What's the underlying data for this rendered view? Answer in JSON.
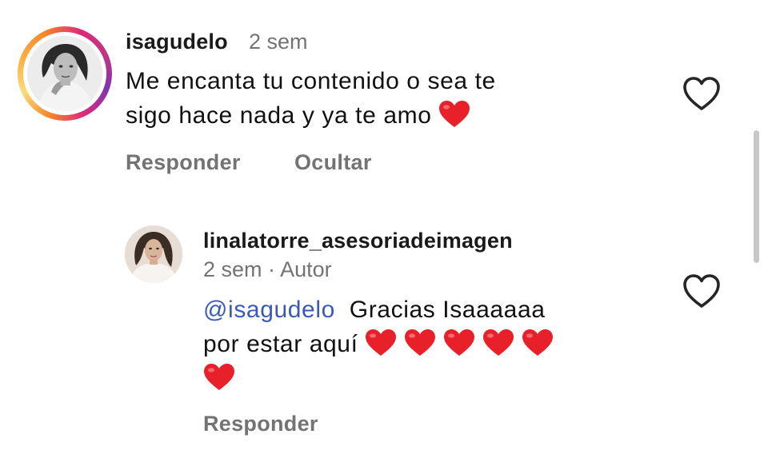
{
  "comment": {
    "username": "isagudelo",
    "time": "2 sem",
    "text_line1": "Me encanta tu contenido o sea te",
    "text_line2": "sigo hace nada y ya te amo",
    "reply_label": "Responder",
    "hide_label": "Ocultar"
  },
  "reply": {
    "username": "linalatorre_asesoriadeimagen",
    "time": "2 sem",
    "separator": "·",
    "author_badge": "Autor",
    "mention": "@isagudelo",
    "text_line1": "Gracias Isaaaaaa",
    "text_line2": "por estar aquí",
    "reply_label": "Responder"
  },
  "icons": {
    "like": "heart-outline-icon",
    "emoji": "red-heart-emoji"
  },
  "colors": {
    "text": "#111111",
    "muted": "#737373",
    "mention": "#3b5ab8",
    "emoji_heart": "#e8202a"
  }
}
